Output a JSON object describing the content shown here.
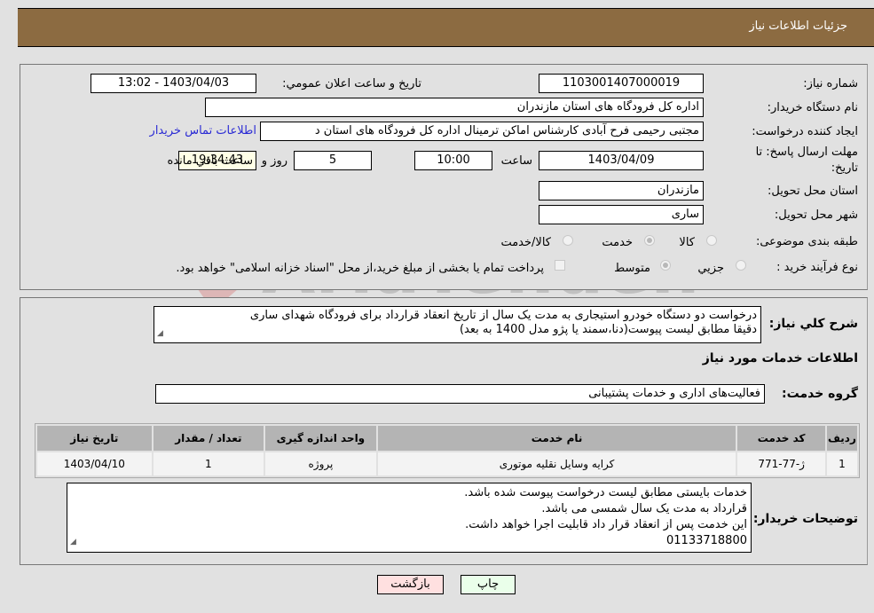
{
  "header": {
    "title": "جزئیات اطلاعات نیاز"
  },
  "details": {
    "need_number_label": "شماره نیاز:",
    "need_number": "1103001407000019",
    "announce_label": "تاريخ و ساعت اعلان عمومي:",
    "announce_value": "1403/04/03 - 13:02",
    "buyer_org_label": "نام دستگاه خریدار:",
    "buyer_org": "اداره کل فرودگاه های استان مازندران",
    "creator_label": "ایجاد کننده درخواست:",
    "creator": "مجتبی رحیمی فرح آبادی کارشناس اماکن ترمینال اداره کل فرودگاه های استان د",
    "contact_link": "اطلاعات تماس خریدار",
    "deadline_label_line1": "مهلت ارسال پاسخ: تا",
    "deadline_label_line2": "تاریخ:",
    "deadline_date": "1403/04/09",
    "time_label": "ساعت",
    "deadline_time": "10:00",
    "days_value": "5",
    "days_label": "روز و",
    "remaining_time": "19:34:43",
    "remaining_label": "ساعت باقي مانده",
    "province_label": "استان محل تحویل:",
    "province": "مازندران",
    "city_label": "شهر محل تحویل:",
    "city": "ساری",
    "category_label": "طبقه بندی موضوعی:",
    "category_options": [
      {
        "label": "کالا",
        "checked": false
      },
      {
        "label": "خدمت",
        "checked": true
      },
      {
        "label": "کالا/خدمت",
        "checked": false
      }
    ],
    "process_label": "نوع فرآیند خرید :",
    "process_options": [
      {
        "label": "جزيي",
        "checked": false
      },
      {
        "label": "متوسط",
        "checked": true
      }
    ],
    "treasury_checkbox_label": "پرداخت تمام یا بخشی از مبلغ خرید،از محل \"اسناد خزانه اسلامی\" خواهد بود.",
    "treasury_checked": false
  },
  "needs": {
    "description_label": "شرح كلي نياز:",
    "description_line1": "درخواست دو دستگاه خودرو استیجاری به مدت یک سال از تاریخ انعقاد قرارداد برای فرودگاه شهدای ساری",
    "description_line2": "دقیقا مطابق لیست پیوست(دنا،سمند یا پژو مدل 1400 به بعد)",
    "services_section_title": "اطلاعات خدمات مورد نیاز",
    "service_group_label": "گروه خدمت:",
    "service_group": "فعالیت‌های اداری و خدمات پشتیبانی",
    "table": {
      "columns": [
        "ردیف",
        "کد خدمت",
        "نام خدمت",
        "واحد اندازه گیری",
        "تعداد / مقدار",
        "تاریخ نیاز"
      ],
      "rows": [
        [
          "1",
          "ژ-77-771",
          "کرایه وسایل نقلیه موتوری",
          "پروژه",
          "1",
          "1403/04/10"
        ]
      ]
    },
    "buyer_notes_label": "توضیحات خریدار:",
    "buyer_notes": [
      "خدمات بایستی مطابق لیست درخواست پیوست شده باشد.",
      "قرارداد به مدت یک سال شمسی می باشد.",
      "این خدمت پس از انعقاد قرار داد قابلیت اجرا خواهد داشت.",
      "01133718800"
    ]
  },
  "buttons": {
    "print": "چاپ",
    "back": "بازگشت"
  },
  "watermark": {
    "text": "AriaTender.neT"
  },
  "colors": {
    "header": "#8c6b41",
    "print_bg": "#eaffea",
    "back_bg": "#ffe0e0",
    "link": "#2a2ad4",
    "remaining_bg": "#ffffe6"
  }
}
